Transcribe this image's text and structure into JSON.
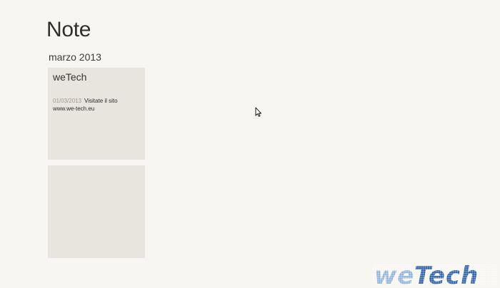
{
  "app": {
    "title": "Note"
  },
  "group": {
    "header": "marzo 2013"
  },
  "notes": [
    {
      "title": "weTech",
      "date": "01/03/2013",
      "text": "Visitate il sito www.we-tech.eu"
    },
    {
      "title": "",
      "date": "",
      "text": ""
    }
  ],
  "icons": {
    "cursor": "mouse-pointer-icon"
  },
  "watermark": {
    "text": "weTech"
  },
  "colors": {
    "background": "#f7f6f2",
    "tile": "#e8e5de",
    "date": "#9f9a8e",
    "watermark_primary": "#2b5fa6",
    "watermark_secondary": "#8fb3d9"
  }
}
